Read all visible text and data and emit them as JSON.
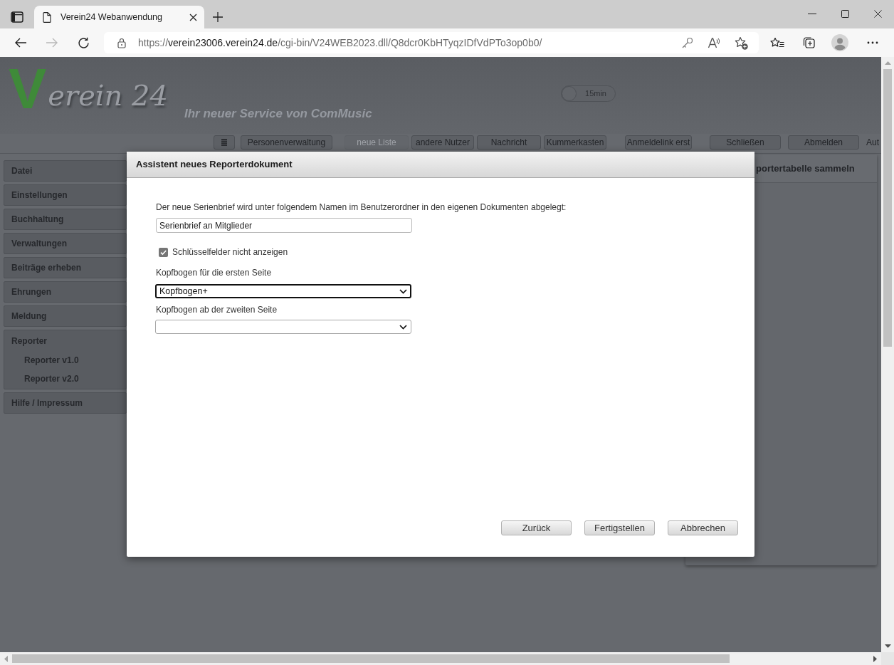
{
  "browser": {
    "tab": {
      "title": "Verein24 Webanwendung",
      "selected": true
    },
    "forward": {
      "disabled": true
    },
    "address": {
      "scheme": "https://",
      "host": "verein23006.verein24.de",
      "path": "/cgi-bin/V24WEB2023.dll/Q8dcr0KbHTyqzIDfVdPTo3op0b0/"
    }
  },
  "header": {
    "logo": "Verein 24",
    "tagline": "Ihr neuer Service von ComMusic",
    "timeout_toggle": {
      "label": "15min",
      "on": false
    }
  },
  "toolbar": {
    "buttons": [
      {
        "kind": "icon",
        "disabled": false
      },
      {
        "kind": "text",
        "label": "Personenverwaltung",
        "disabled": false
      },
      {
        "kind": "text",
        "label": "neue Liste",
        "disabled": true
      },
      {
        "kind": "text",
        "label": "andere Nutzer",
        "disabled": false
      },
      {
        "kind": "text",
        "label": "Nachricht",
        "disabled": false
      },
      {
        "kind": "text",
        "label": "Kummerkasten",
        "disabled": false
      },
      {
        "kind": "text",
        "label": "Anmeldelink erst",
        "disabled": false
      },
      {
        "kind": "text",
        "label": "Schließen",
        "disabled": false
      },
      {
        "kind": "text",
        "label": "Abmelden",
        "disabled": false
      }
    ],
    "trailing_text": "Aut"
  },
  "sidebar": {
    "items": [
      {
        "label": "Datei"
      },
      {
        "label": "Einstellungen"
      },
      {
        "label": "Buchhaltung"
      },
      {
        "label": "Verwaltungen"
      },
      {
        "label": "Beiträge erheben"
      },
      {
        "label": "Ehrungen"
      },
      {
        "label": "Meldung"
      },
      {
        "label": "Reporter",
        "children": [
          {
            "label": "Reporter v1.0"
          },
          {
            "label": "Reporter v2.0"
          }
        ]
      },
      {
        "label": "Hilfe / Impressum"
      }
    ]
  },
  "side_panel": {
    "title": "portertabelle sammeln"
  },
  "dialog": {
    "title": "Assistent neues Reporterdokument",
    "intro": "Der neue Serienbrief wird unter folgendem Namen im Benutzerordner in den eigenen Dokumenten abgelegt:",
    "name_field": {
      "value": "Serienbrief an Mitglieder"
    },
    "hide_key_fields": {
      "label": "Schlüsselfelder nicht anzeigen",
      "checked": true
    },
    "first_page_letterhead": {
      "label": "Kopfbogen für die ersten Seite",
      "value": "Kopfbogen+",
      "focused": true
    },
    "following_pages_letterhead": {
      "label": "Kopfbogen ab der zweiten Seite",
      "focused": false
    },
    "buttons": [
      "Zurück",
      "Fertigstellen",
      "Abbrechen"
    ]
  }
}
